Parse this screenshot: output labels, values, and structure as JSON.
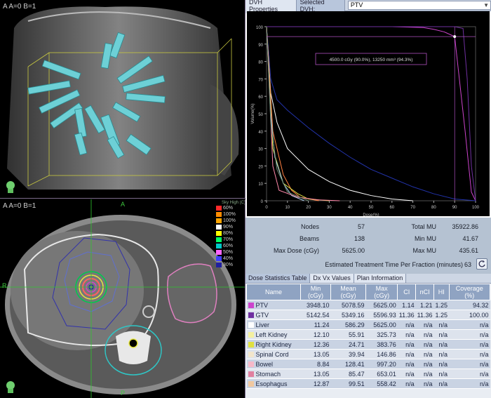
{
  "viewport_3d": {
    "label": "A=0  B=1",
    "tag": "A",
    "head_icon": "head-orientation-icon"
  },
  "viewport_axial": {
    "label": "A=0  B=1",
    "tag": "A",
    "isodose_header": "Sky High (C)",
    "isodose_levels": [
      "60%",
      "100%",
      "100%",
      "90%",
      "80%",
      "70%",
      "60%",
      "50%",
      "40%",
      "30%"
    ],
    "isodose_colors": [
      "#ff2a2a",
      "#ff8c00",
      "#ffa500",
      "#ffffff",
      "#ffff00",
      "#00ff66",
      "#00c8c8",
      "#ff66ff",
      "#4040ff",
      "#2020a0"
    ],
    "orient": {
      "top": "A",
      "left": "R",
      "bottom": "P"
    },
    "head_icon": "head-orientation-icon"
  },
  "dvh": {
    "tabs": [
      "DVH Properties",
      "Selected DVH:"
    ],
    "selected_value": "PTV",
    "tooltip": "4500.0 cGy (90.0%), 13250 mm³ (94.3%)",
    "ylabel": "Volume(%)",
    "xlabel": "Dose(%)",
    "yticks": [
      "100",
      "90",
      "80",
      "70",
      "60",
      "50",
      "40",
      "30",
      "20",
      "10",
      "0"
    ],
    "xticks": [
      "0",
      "10",
      "20",
      "30",
      "40",
      "50",
      "60",
      "70",
      "80",
      "90",
      "100"
    ]
  },
  "chart_data": {
    "type": "line",
    "xlabel": "Dose(%)",
    "ylabel": "Volume(%)",
    "xlim": [
      0,
      100
    ],
    "ylim": [
      0,
      100
    ],
    "series": [
      {
        "name": "PTV",
        "color": "#cc44cc",
        "x": [
          0,
          60,
          75,
          80,
          85,
          90,
          95,
          98,
          100
        ],
        "y": [
          100,
          100,
          99.5,
          98.5,
          97,
          94.3,
          40,
          5,
          0
        ]
      },
      {
        "name": "GTV",
        "color": "#7030a0",
        "x": [
          0,
          80,
          90,
          94,
          96,
          98,
          100
        ],
        "y": [
          100,
          100,
          100,
          99,
          70,
          20,
          0
        ]
      },
      {
        "name": "Liver",
        "color": "#2233aa",
        "x": [
          0,
          2,
          5,
          10,
          20,
          30,
          40,
          50,
          60,
          70,
          80,
          90,
          100
        ],
        "y": [
          100,
          70,
          58,
          52,
          42,
          33,
          25,
          18,
          13,
          8,
          4,
          1,
          0
        ]
      },
      {
        "name": "Stomach",
        "color": "#ffffff",
        "x": [
          0,
          2,
          5,
          10,
          20,
          30,
          40,
          50,
          60,
          70
        ],
        "y": [
          100,
          62,
          45,
          30,
          18,
          11,
          6,
          3,
          1,
          0
        ]
      },
      {
        "name": "Left Kidney",
        "color": "#ff8040",
        "x": [
          0,
          3,
          8,
          12,
          16,
          25
        ],
        "y": [
          100,
          40,
          15,
          6,
          2,
          0
        ]
      },
      {
        "name": "Right Kidney",
        "color": "#e0e040",
        "x": [
          0,
          3,
          8,
          15,
          20,
          30
        ],
        "y": [
          100,
          30,
          10,
          4,
          1,
          0
        ]
      },
      {
        "name": "Spinal Cord",
        "color": "#b0d0f0",
        "x": [
          0,
          2,
          4,
          8,
          12,
          18
        ],
        "y": [
          100,
          50,
          25,
          10,
          3,
          0
        ]
      },
      {
        "name": "Bowel",
        "color": "#ff88aa",
        "x": [
          0,
          3,
          6,
          15,
          25,
          35
        ],
        "y": [
          100,
          20,
          6,
          2,
          0.5,
          0
        ]
      },
      {
        "name": "Esophagus",
        "color": "#6a8a70",
        "x": [
          0,
          2,
          5,
          10,
          20
        ],
        "y": [
          100,
          45,
          18,
          5,
          0
        ]
      }
    ],
    "marker": {
      "x": 90,
      "y": 94.3
    }
  },
  "summary": {
    "nodes_label": "Nodes",
    "nodes": "57",
    "beams_label": "Beams",
    "beams": "138",
    "maxdose_label": "Max Dose (cGy)",
    "maxdose": "5625.00",
    "totalmu_label": "Total MU",
    "totalmu": "35922.86",
    "minmu_label": "Min MU",
    "minmu": "41.67",
    "maxmu_label": "Max MU",
    "maxmu": "435.61",
    "time_label": "Estimated Treatment Time Per Fraction (minutes)",
    "time": "63"
  },
  "stats": {
    "tabs": [
      "Dose Statistics Table",
      "Dx Vx Values",
      "Plan Information"
    ],
    "headers": [
      "Name",
      "Min (cGy)",
      "Mean (cGy)",
      "Max (cGy)",
      "CI",
      "nCI",
      "HI",
      "Coverage (%)"
    ],
    "rows": [
      {
        "color": "#cc44cc",
        "cells": [
          "PTV",
          "3948.10",
          "5078.59",
          "5625.00",
          "1.14",
          "1.21",
          "1.25",
          "94.32"
        ]
      },
      {
        "color": "#7030a0",
        "cells": [
          "GTV",
          "5142.54",
          "5349.16",
          "5596.93",
          "11.36",
          "11.36",
          "1.25",
          "100.00"
        ]
      },
      {
        "color": "#ffffff",
        "cells": [
          "Liver",
          "11.24",
          "586.29",
          "5625.00",
          "n/a",
          "n/a",
          "n/a",
          "n/a"
        ]
      },
      {
        "color": "#f4f0a0",
        "cells": [
          "Left Kidney",
          "12.10",
          "55.91",
          "325.73",
          "n/a",
          "n/a",
          "n/a",
          "n/a"
        ]
      },
      {
        "color": "#e0e040",
        "cells": [
          "Right Kidney",
          "12.36",
          "24.71",
          "383.76",
          "n/a",
          "n/a",
          "n/a",
          "n/a"
        ]
      },
      {
        "color": "#f2e6cc",
        "cells": [
          "Spinal Cord",
          "13.05",
          "39.94",
          "146.86",
          "n/a",
          "n/a",
          "n/a",
          "n/a"
        ]
      },
      {
        "color": "#f6b8c8",
        "cells": [
          "Bowel",
          "8.84",
          "128.41",
          "997.20",
          "n/a",
          "n/a",
          "n/a",
          "n/a"
        ]
      },
      {
        "color": "#e080a0",
        "cells": [
          "Stomach",
          "13.05",
          "85.47",
          "653.01",
          "n/a",
          "n/a",
          "n/a",
          "n/a"
        ]
      },
      {
        "color": "#f0c8a0",
        "cells": [
          "Esophagus",
          "12.87",
          "99.51",
          "558.42",
          "n/a",
          "n/a",
          "n/a",
          "n/a"
        ]
      }
    ]
  }
}
